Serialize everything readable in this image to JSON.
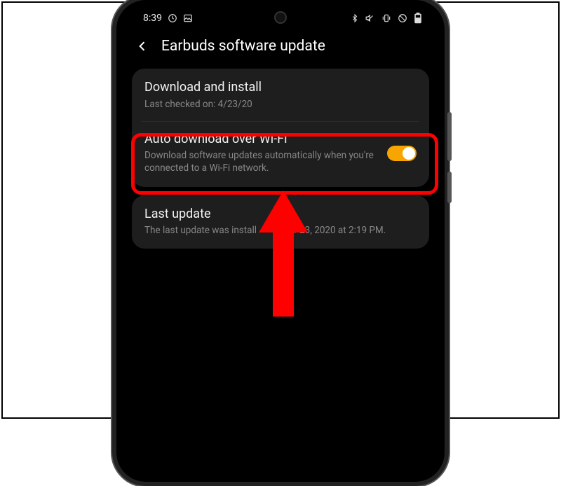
{
  "statusbar": {
    "time": "8:39",
    "icons_left": [
      "clock-icon",
      "image-icon"
    ],
    "icons_right": [
      "bluetooth-icon",
      "mute-icon",
      "vibrate-icon",
      "dnd-icon",
      "battery-icon"
    ]
  },
  "header": {
    "title": "Earbuds software update"
  },
  "card1": {
    "download": {
      "title": "Download and install",
      "sub": "Last checked on: 4/23/20"
    },
    "auto": {
      "title": "Auto download over Wi-Fi",
      "sub": "Download software updates automatically when you're connected to a Wi-Fi network.",
      "toggle": "on"
    }
  },
  "card2": {
    "last": {
      "title": "Last update",
      "sub_before": "The last update was install",
      "sub_after": "r 23, 2020 at 2:19 PM."
    }
  }
}
